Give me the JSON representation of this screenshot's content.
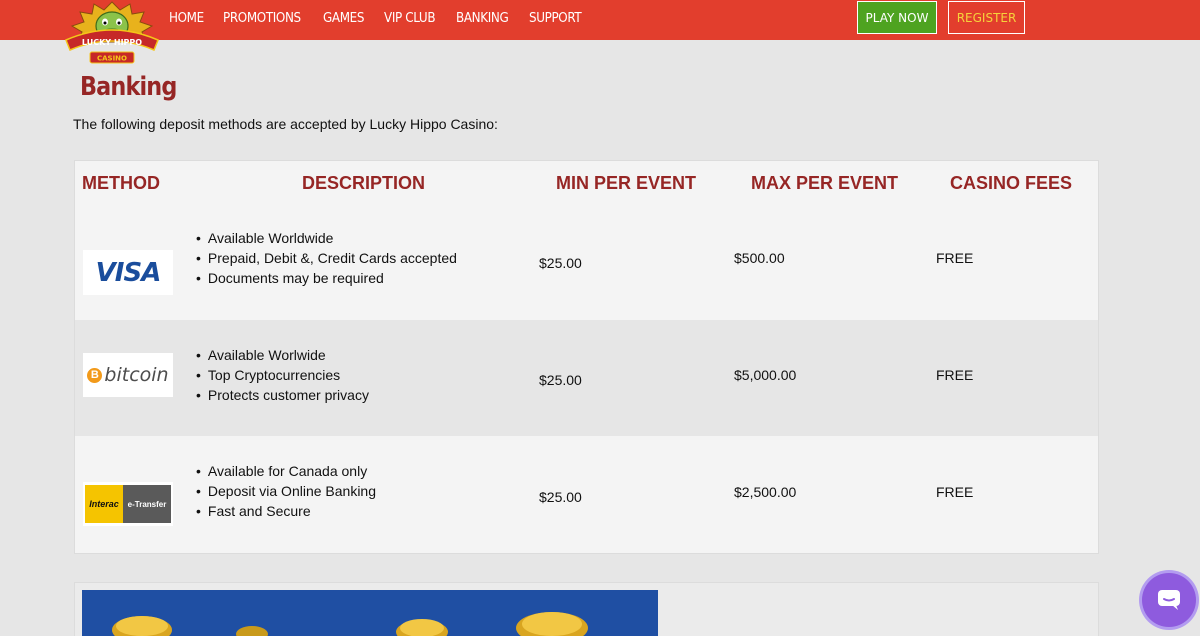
{
  "nav": {
    "items": [
      "HOME",
      "PROMOTIONS",
      "GAMES",
      "VIP CLUB",
      "BANKING",
      "SUPPORT"
    ],
    "play_now": "PLAY NOW",
    "register": "REGISTER"
  },
  "logo": {
    "text_top": "LUCKY HIPPO",
    "text_bottom": "CASINO"
  },
  "page": {
    "title": "Banking",
    "intro": "The following deposit methods are accepted by Lucky Hippo Casino:"
  },
  "table": {
    "headers": [
      "METHOD",
      "DESCRIPTION",
      "MIN PER EVENT",
      "MAX PER EVENT",
      "CASINO FEES"
    ],
    "rows": [
      {
        "logo_text": "VISA",
        "description": [
          "Available Worldwide",
          "Prepaid, Debit &, Credit Cards accepted",
          "Documents may be required"
        ],
        "min": "$25.00",
        "max": "$500.00",
        "fees": "FREE"
      },
      {
        "logo_text": "bitcoin",
        "logo_symbol": "B",
        "description": [
          "Available Worlwide",
          "Top Cryptocurrencies",
          "Protects customer privacy"
        ],
        "min": "$25.00",
        "max": "$5,000.00",
        "fees": "FREE"
      },
      {
        "logo_text": "Interac",
        "logo_text2": "e-Transfer",
        "description": [
          "Available for Canada only",
          "Deposit via Online Banking",
          "Fast and Secure"
        ],
        "min": "$25.00",
        "max": "$2,500.00",
        "fees": "FREE"
      }
    ]
  },
  "colors": {
    "topbar": "#e23e2d",
    "heading": "#962625",
    "play": "#4ea320",
    "register_text": "#f6d23b",
    "chat": "#8e5bde"
  },
  "icons": {
    "chat": "chat-icon"
  }
}
